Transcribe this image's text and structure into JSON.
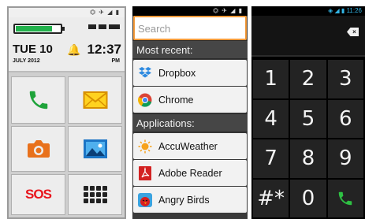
{
  "launcher": {
    "date": "TUE 10",
    "month_year": "JULY 2012",
    "time": "12:37",
    "ampm": "PM",
    "battery_fraction": 0.82,
    "status_icons": "⏣ ✈ ◢ ▮",
    "tiles": [
      {
        "icon": "phone-icon",
        "color": "#1ea33a"
      },
      {
        "icon": "mail-icon",
        "color": "#f0a800"
      },
      {
        "icon": "camera-icon",
        "color": "#e8711c"
      },
      {
        "icon": "gallery-icon",
        "color": "#1b74c5"
      },
      {
        "icon": "sos-icon",
        "label": "SOS",
        "color": "#e8151c"
      },
      {
        "icon": "apps-grid-icon",
        "color": "#222222"
      }
    ]
  },
  "app_list": {
    "status_icons": "⏣ ✈ ◢ ▮",
    "search_placeholder": "Search",
    "recent_header": "Most recent:",
    "recent": [
      {
        "label": "Dropbox",
        "icon": "dropbox-icon"
      },
      {
        "label": "Chrome",
        "icon": "chrome-icon"
      }
    ],
    "apps_header": "Applications:",
    "apps": [
      {
        "label": "AccuWeather",
        "icon": "sun-icon"
      },
      {
        "label": "Adobe Reader",
        "icon": "adobe-reader-icon"
      },
      {
        "label": "Angry Birds",
        "icon": "angry-birds-icon"
      }
    ]
  },
  "dialer": {
    "status_time": "11:26",
    "status_icons": "◈ ◢ ▮",
    "keys": [
      "1",
      "2",
      "3",
      "4",
      "5",
      "6",
      "7",
      "8",
      "9",
      "#*",
      "0"
    ],
    "delete_glyph": "×",
    "call_color": "#2ec043"
  }
}
